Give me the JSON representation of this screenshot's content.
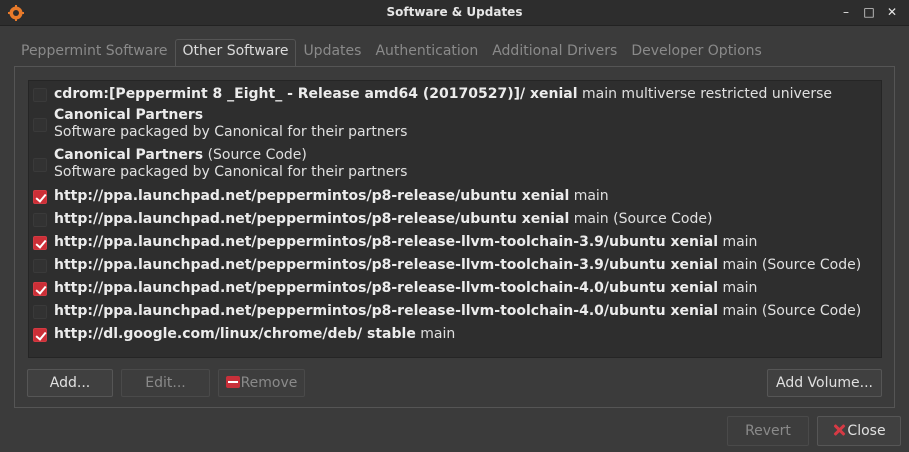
{
  "window": {
    "title": "Software & Updates",
    "controls": [
      "–",
      "□",
      "✕"
    ]
  },
  "tabs": [
    {
      "label": "Peppermint Software",
      "active": false
    },
    {
      "label": "Other Software",
      "active": true
    },
    {
      "label": "Updates",
      "active": false
    },
    {
      "label": "Authentication",
      "active": false
    },
    {
      "label": "Additional Drivers",
      "active": false
    },
    {
      "label": "Developer Options",
      "active": false
    }
  ],
  "sources": [
    {
      "checked": false,
      "bold": "cdrom:[Peppermint 8 _Eight_ - Release amd64 (20170527)]/ xenial",
      "rest": " main multiverse restricted universe",
      "sub": ""
    },
    {
      "checked": false,
      "bold": "Canonical Partners",
      "rest": "",
      "sub": "Software packaged by Canonical for their partners"
    },
    {
      "checked": false,
      "bold": "Canonical Partners",
      "rest": " (Source Code)",
      "sub": "Software packaged by Canonical for their partners"
    },
    {
      "checked": true,
      "bold": "http://ppa.launchpad.net/peppermintos/p8-release/ubuntu xenial",
      "rest": " main",
      "sub": ""
    },
    {
      "checked": false,
      "bold": "http://ppa.launchpad.net/peppermintos/p8-release/ubuntu xenial",
      "rest": " main (Source Code)",
      "sub": ""
    },
    {
      "checked": true,
      "bold": "http://ppa.launchpad.net/peppermintos/p8-release-llvm-toolchain-3.9/ubuntu xenial",
      "rest": " main",
      "sub": ""
    },
    {
      "checked": false,
      "bold": "http://ppa.launchpad.net/peppermintos/p8-release-llvm-toolchain-3.9/ubuntu xenial",
      "rest": " main (Source Code)",
      "sub": ""
    },
    {
      "checked": true,
      "bold": "http://ppa.launchpad.net/peppermintos/p8-release-llvm-toolchain-4.0/ubuntu xenial",
      "rest": " main",
      "sub": ""
    },
    {
      "checked": false,
      "bold": "http://ppa.launchpad.net/peppermintos/p8-release-llvm-toolchain-4.0/ubuntu xenial",
      "rest": " main (Source Code)",
      "sub": ""
    },
    {
      "checked": true,
      "bold": "http://dl.google.com/linux/chrome/deb/ stable",
      "rest": " main",
      "sub": ""
    }
  ],
  "buttons": {
    "add": "Add...",
    "edit": "Edit...",
    "remove": "Remove",
    "add_volume": "Add Volume...",
    "revert": "Revert",
    "close": "Close"
  },
  "colors": {
    "accent": "#cc2f37",
    "background": "#3b3b3b",
    "list_background": "#2e2e2e"
  }
}
